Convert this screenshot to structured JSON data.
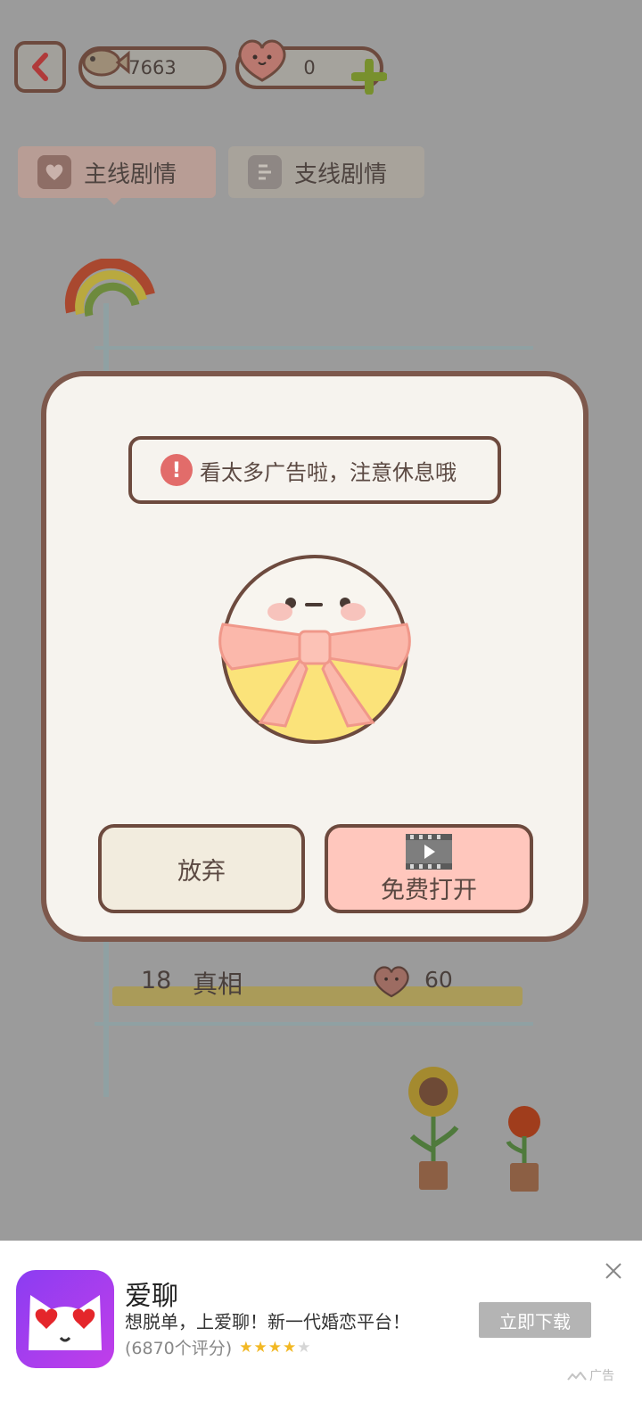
{
  "topbar": {
    "fish_count": "7663",
    "heart_count": "0"
  },
  "tabs": [
    {
      "label": "主线剧情"
    },
    {
      "label": "支线剧情"
    }
  ],
  "story_list": {
    "row": {
      "number": "18",
      "title": "真相",
      "cost": "60"
    }
  },
  "dialog": {
    "warning_text": "看太多广告啦，注意休息哦",
    "warning_icon": "!",
    "give_up_label": "放弃",
    "open_free_label": "免费打开"
  },
  "ad": {
    "app_name": "爱聊",
    "description": "想脱单，上爱聊！新一代婚恋平台！",
    "rating_count": "(6870个评分)",
    "rating_stars": 4,
    "download_label": "立即下载",
    "ad_tag": "广告"
  },
  "colors": {
    "overlay": "#9b9b9b",
    "dialog_border": "#7d584c",
    "open_button": "#ffc7bd",
    "ad_brand": "#8b3df2"
  }
}
